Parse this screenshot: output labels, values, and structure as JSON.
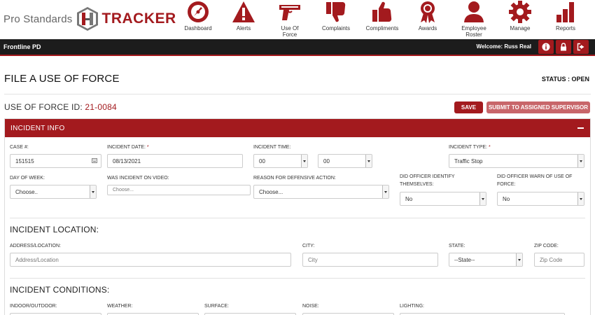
{
  "brand": {
    "pre": "Pro Standards",
    "name": "TRACKER",
    "accent": "#a31a1e"
  },
  "nav": [
    {
      "label": "Dashboard",
      "icon": "speedometer-icon"
    },
    {
      "label": "Alerts",
      "icon": "alert-triangle-icon"
    },
    {
      "label": "Use Of Force",
      "icon": "handgun-icon"
    },
    {
      "label": "Complaints",
      "icon": "thumbs-down-icon"
    },
    {
      "label": "Compliments",
      "icon": "thumbs-up-icon"
    },
    {
      "label": "Awards",
      "icon": "award-ribbon-icon"
    },
    {
      "label": "Employee Roster",
      "icon": "person-icon"
    },
    {
      "label": "Manage",
      "icon": "gear-icon"
    },
    {
      "label": "Reports",
      "icon": "bar-chart-icon"
    }
  ],
  "subbar": {
    "agency": "Frontline PD",
    "welcome": "Welcome: Russ Real",
    "buttons": [
      "info-icon",
      "lock-icon",
      "logout-icon"
    ]
  },
  "page": {
    "title": "FILE A USE OF FORCE",
    "status": "STATUS : OPEN",
    "uof_label": "USE OF FORCE ID:",
    "uof_id": "21-0084",
    "save": "SAVE",
    "submit": "SUBMIT TO ASSIGNED SUPERVISOR"
  },
  "panel": {
    "title": "INCIDENT INFO"
  },
  "form": {
    "case_label": "CASE #:",
    "case_value": "151515",
    "date_label": "INCIDENT DATE:",
    "date_value": "08/13/2021",
    "time_label": "INCIDENT TIME:",
    "time_hour": "00",
    "time_min": "00",
    "type_label": "INCIDENT TYPE:",
    "type_value": "Traffic Stop",
    "dow_label": "DAY OF WEEK:",
    "dow_value": "Choose..",
    "video_label": "WAS INCIDENT ON VIDEO:",
    "video_placeholder": "Choose...",
    "reason_label": "REASON FOR DEFENSIVE ACTION:",
    "reason_value": "Choose...",
    "identify_label_1": "DID OFFICER IDENTIFY",
    "identify_label_2": "THEMSELVES:",
    "identify_value": "No",
    "warn_label_1": "DID OFFICER WARN OF USE OF",
    "warn_label_2": "FORCE:",
    "warn_value": "No"
  },
  "location": {
    "title": "INCIDENT LOCATION:",
    "address_label": "ADDRESS/LOCATION:",
    "address_placeholder": "Address/Location",
    "city_label": "CITY:",
    "city_placeholder": "City",
    "state_label": "STATE:",
    "state_value": "--State--",
    "zip_label": "ZIP CODE:",
    "zip_placeholder": "Zip Code"
  },
  "conditions": {
    "title": "INCIDENT CONDITIONS:",
    "indoor_label": "INDOOR/OUTDOOR:",
    "weather_label": "WEATHER:",
    "surface_label": "SURFACE:",
    "noise_label": "NOISE:",
    "lighting_label": "LIGHTING:"
  }
}
